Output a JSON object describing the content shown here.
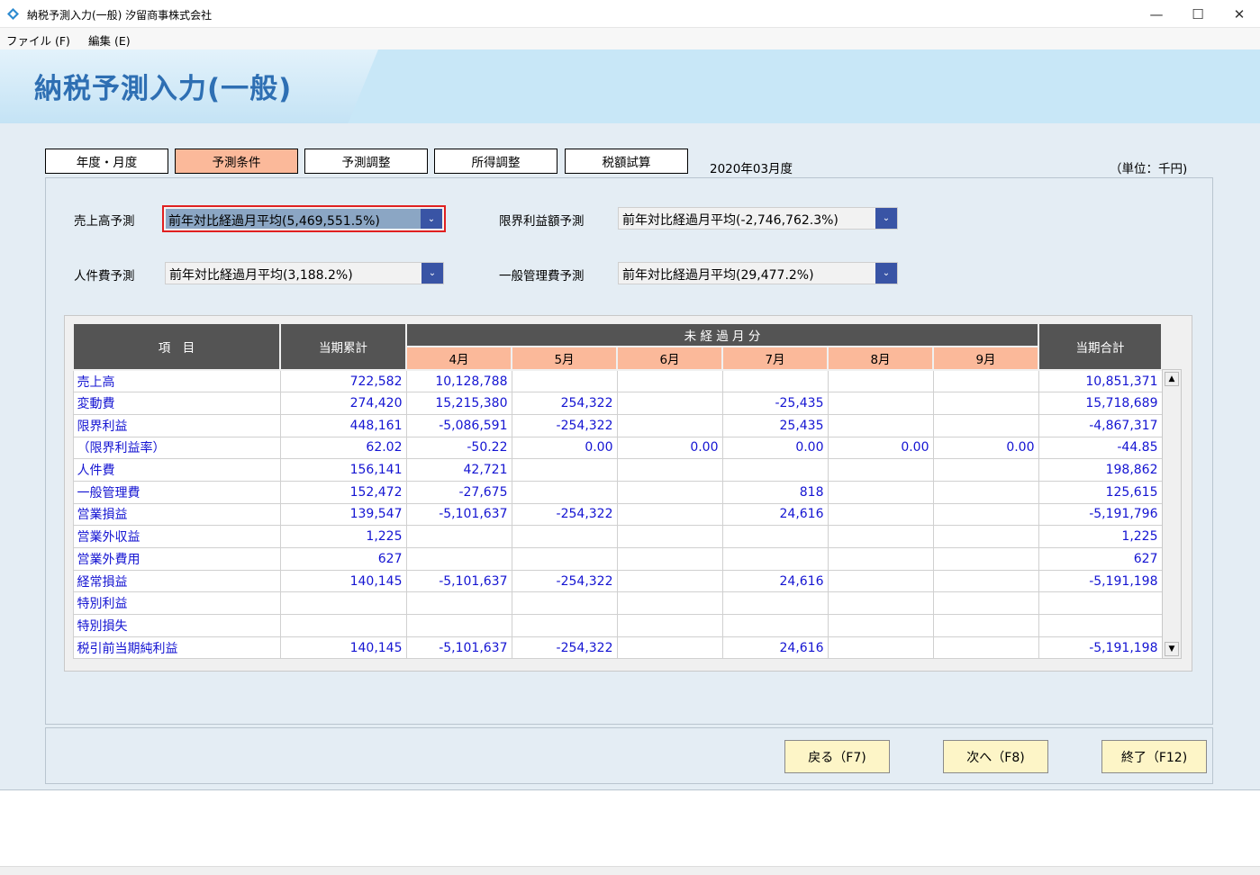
{
  "window": {
    "title": "納税予測入力(一般) 汐留商事株式会社",
    "minimize": "—",
    "maximize": "☐",
    "close": "✕"
  },
  "menu": [
    {
      "label": "ファイル (F)"
    },
    {
      "label": "編集 (E)"
    }
  ],
  "banner": {
    "title": "納税予測入力(一般)"
  },
  "tabs": [
    {
      "label": "年度・月度"
    },
    {
      "label": "予測条件"
    },
    {
      "label": "予測調整"
    },
    {
      "label": "所得調整"
    },
    {
      "label": "税額試算"
    }
  ],
  "active_tab": "予測条件",
  "period": "2020年03月度",
  "unit": "（単位：千円)",
  "forecast": {
    "sales_label": "売上高予測",
    "sales_value": "前年対比経過月平均(5,469,551.5%)",
    "margin_label": "限界利益額予測",
    "margin_value": "前年対比経過月平均(-2,746,762.3%)",
    "personnel_label": "人件費予測",
    "personnel_value": "前年対比経過月平均(3,188.2%)",
    "admin_label": "一般管理費予測",
    "admin_value": "前年対比経過月平均(29,477.2%)"
  },
  "grid": {
    "col_item": "項　目",
    "col_cumulative": "当期累計",
    "col_unelapsed": "未 経 過 月 分",
    "col_total": "当期合計",
    "months": [
      "4月",
      "5月",
      "6月",
      "7月",
      "8月",
      "9月"
    ],
    "rows": [
      {
        "name": "売上高",
        "cum": "722,582",
        "m": [
          "10,128,788",
          "",
          "",
          "",
          "",
          ""
        ],
        "total": "10,851,371"
      },
      {
        "name": "変動費",
        "cum": "274,420",
        "m": [
          "15,215,380",
          "254,322",
          "",
          "-25,435",
          "",
          ""
        ],
        "total": "15,718,689"
      },
      {
        "name": "限界利益",
        "cum": "448,161",
        "m": [
          "-5,086,591",
          "-254,322",
          "",
          "25,435",
          "",
          ""
        ],
        "total": "-4,867,317"
      },
      {
        "name": "（限界利益率）",
        "cum": "62.02",
        "m": [
          "-50.22",
          "0.00",
          "0.00",
          "0.00",
          "0.00",
          "0.00"
        ],
        "total": "-44.85"
      },
      {
        "name": "人件費",
        "cum": "156,141",
        "m": [
          "42,721",
          "",
          "",
          "",
          "",
          ""
        ],
        "total": "198,862"
      },
      {
        "name": "一般管理費",
        "cum": "152,472",
        "m": [
          "-27,675",
          "",
          "",
          "818",
          "",
          ""
        ],
        "total": "125,615"
      },
      {
        "name": "営業損益",
        "cum": "139,547",
        "m": [
          "-5,101,637",
          "-254,322",
          "",
          "24,616",
          "",
          ""
        ],
        "total": "-5,191,796"
      },
      {
        "name": "営業外収益",
        "cum": "1,225",
        "m": [
          "",
          "",
          "",
          "",
          "",
          ""
        ],
        "total": "1,225"
      },
      {
        "name": "営業外費用",
        "cum": "627",
        "m": [
          "",
          "",
          "",
          "",
          "",
          ""
        ],
        "total": "627"
      },
      {
        "name": "経常損益",
        "cum": "140,145",
        "m": [
          "-5,101,637",
          "-254,322",
          "",
          "24,616",
          "",
          ""
        ],
        "total": "-5,191,198"
      },
      {
        "name": "特別利益",
        "cum": "",
        "m": [
          "",
          "",
          "",
          "",
          "",
          ""
        ],
        "total": ""
      },
      {
        "name": "特別損失",
        "cum": "",
        "m": [
          "",
          "",
          "",
          "",
          "",
          ""
        ],
        "total": ""
      },
      {
        "name": "税引前当期純利益",
        "cum": "140,145",
        "m": [
          "-5,101,637",
          "-254,322",
          "",
          "24,616",
          "",
          ""
        ],
        "total": "-5,191,198"
      }
    ]
  },
  "footer": {
    "back": "戻る（F7)",
    "next": "次へ（F8)",
    "exit": "終了（F12)"
  },
  "colors": {
    "active_tab": "#fbb99a",
    "header_dark": "#545454",
    "value_text": "#1414d2",
    "button_bg": "#fdf5c7",
    "banner_title": "#2e6fb3"
  }
}
